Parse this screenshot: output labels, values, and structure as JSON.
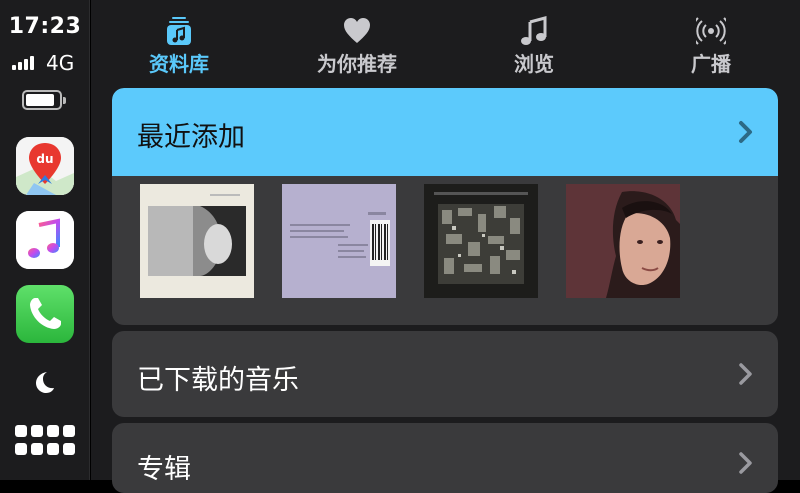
{
  "status": {
    "time": "17:23",
    "network": "4G"
  },
  "dock": {
    "apps": [
      {
        "name": "Baidu Maps",
        "icon": "maps-icon",
        "badge_text": "du"
      },
      {
        "name": "Music",
        "icon": "music-note-icon"
      },
      {
        "name": "Phone",
        "icon": "phone-icon"
      }
    ]
  },
  "tabs": [
    {
      "label": "资料库",
      "icon": "library-icon",
      "active": true
    },
    {
      "label": "为你推荐",
      "icon": "heart-icon",
      "active": false
    },
    {
      "label": "浏览",
      "icon": "music-note-icon",
      "active": false
    },
    {
      "label": "广播",
      "icon": "broadcast-icon",
      "active": false
    }
  ],
  "library": {
    "recently_added": {
      "label": "最近添加",
      "albums": [
        {
          "art": "album-cover-bw-portrait"
        },
        {
          "art": "album-cover-lavender-barcode"
        },
        {
          "art": "album-cover-dark-collage"
        },
        {
          "art": "album-cover-maroon-portrait"
        }
      ]
    },
    "downloaded_music": {
      "label": "已下载的音乐"
    },
    "albums": {
      "label": "专辑"
    }
  },
  "colors": {
    "accent": "#5ac8fa",
    "highlight_row": "#5ccafc",
    "card": "#3a3a3c",
    "background": "#1c1c1e"
  }
}
